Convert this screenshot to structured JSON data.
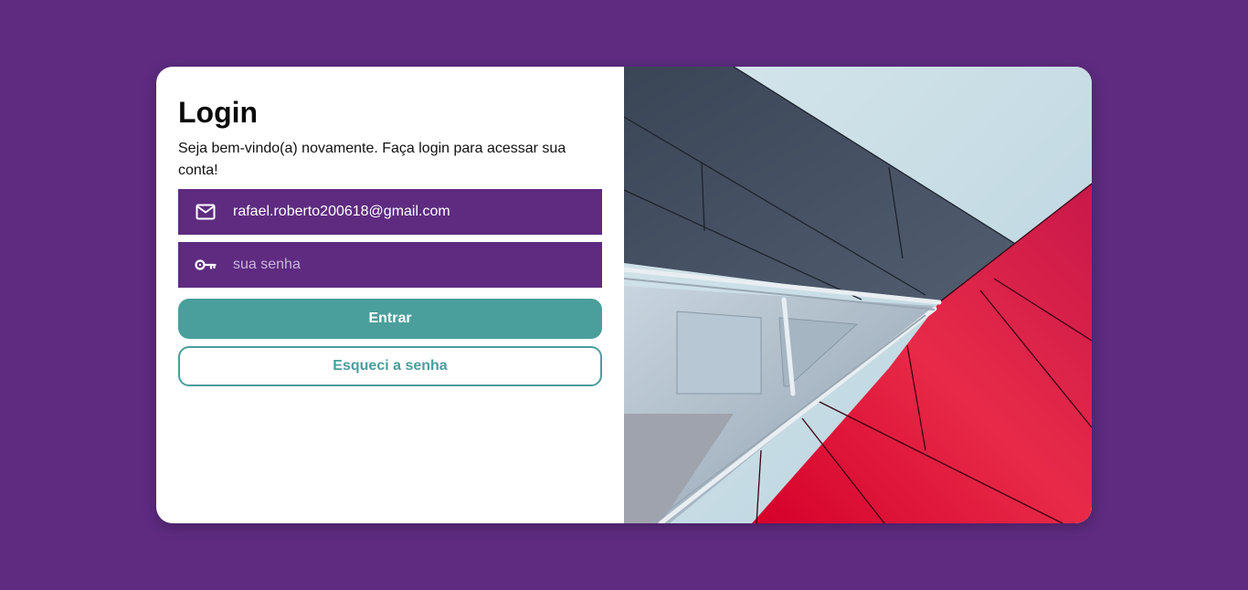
{
  "login": {
    "title": "Login",
    "subtitle": "Seja bem-vindo(a) novamente. Faça login para acessar sua conta!",
    "email": {
      "icon": "mail-icon",
      "value": "rafael.roberto200618@gmail.com"
    },
    "password": {
      "icon": "key-icon",
      "placeholder": "sua senha",
      "value": ""
    },
    "submit_label": "Entrar",
    "forgot_label": "Esqueci a senha"
  },
  "colors": {
    "background": "#5e2b80",
    "field": "#5e2b80",
    "accent": "#4a9e9c",
    "card": "#ffffff"
  },
  "hero_image": {
    "subject": "modern building facade with dark grey and red panels against a pale sky"
  }
}
